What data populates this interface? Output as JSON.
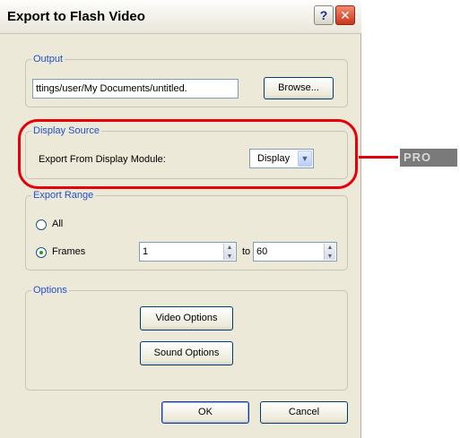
{
  "window": {
    "title": "Export to Flash Video",
    "help_glyph": "?",
    "close_glyph": "✕"
  },
  "output": {
    "group_label": "Output",
    "path_value": "ttings/user/My Documents/untitled.",
    "browse_label": "Browse..."
  },
  "display_source": {
    "group_label": "Display Source",
    "label": "Export From Display Module:",
    "selected": "Display"
  },
  "export_range": {
    "group_label": "Export Range",
    "all_label": "All",
    "frames_label": "Frames",
    "selected": "Frames",
    "from_value": "1",
    "to_label": "to",
    "to_value": "60"
  },
  "options": {
    "group_label": "Options",
    "video_label": "Video Options",
    "sound_label": "Sound Options"
  },
  "footer": {
    "ok_label": "OK",
    "cancel_label": "Cancel"
  },
  "annotation": {
    "badge_text": "PRO",
    "color": "#e5000a"
  }
}
